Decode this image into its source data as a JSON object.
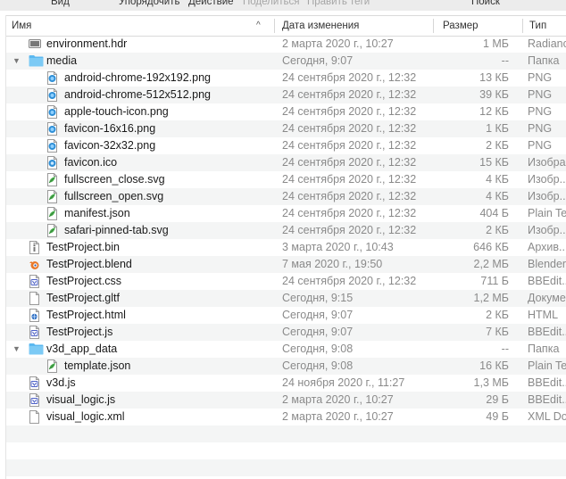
{
  "toolbar": {
    "items": [
      "Вид",
      "Упорядочить",
      "Действие",
      "Поделиться",
      "Править теги",
      "Поиск"
    ]
  },
  "columns": {
    "name": "Имя",
    "sort_indicator": "^",
    "date": "Дата изменения",
    "size": "Размер",
    "type": "Тип"
  },
  "files": [
    {
      "name": "environment.hdr",
      "date": "2 марта 2020 г., 10:27",
      "size": "1 МБ",
      "type": "Radiance",
      "level": 0,
      "icon": "hdr-file-icon"
    },
    {
      "name": "media",
      "date": "Сегодня, 9:07",
      "size": "--",
      "type": "Папка",
      "level": 0,
      "icon": "folder-icon",
      "expanded": true
    },
    {
      "name": "android-chrome-192x192.png",
      "date": "24 сентября 2020 г., 12:32",
      "size": "13 КБ",
      "type": "PNG",
      "level": 1,
      "icon": "png-file-icon"
    },
    {
      "name": "android-chrome-512x512.png",
      "date": "24 сентября 2020 г., 12:32",
      "size": "39 КБ",
      "type": "PNG",
      "level": 1,
      "icon": "png-file-icon"
    },
    {
      "name": "apple-touch-icon.png",
      "date": "24 сентября 2020 г., 12:32",
      "size": "12 КБ",
      "type": "PNG",
      "level": 1,
      "icon": "png-file-icon"
    },
    {
      "name": "favicon-16x16.png",
      "date": "24 сентября 2020 г., 12:32",
      "size": "1 КБ",
      "type": "PNG",
      "level": 1,
      "icon": "png-file-icon"
    },
    {
      "name": "favicon-32x32.png",
      "date": "24 сентября 2020 г., 12:32",
      "size": "2 КБ",
      "type": "PNG",
      "level": 1,
      "icon": "png-file-icon"
    },
    {
      "name": "favicon.ico",
      "date": "24 сентября 2020 г., 12:32",
      "size": "15 КБ",
      "type": "Изобра",
      "level": 1,
      "icon": "ico-file-icon"
    },
    {
      "name": "fullscreen_close.svg",
      "date": "24 сентября 2020 г., 12:32",
      "size": "4 КБ",
      "type": "Изобр...",
      "level": 1,
      "icon": "svg-file-icon"
    },
    {
      "name": "fullscreen_open.svg",
      "date": "24 сентября 2020 г., 12:32",
      "size": "4 КБ",
      "type": "Изобр...",
      "level": 1,
      "icon": "svg-file-icon"
    },
    {
      "name": "manifest.json",
      "date": "24 сентября 2020 г., 12:32",
      "size": "404 Б",
      "type": "Plain Te",
      "level": 1,
      "icon": "json-file-icon"
    },
    {
      "name": "safari-pinned-tab.svg",
      "date": "24 сентября 2020 г., 12:32",
      "size": "2 КБ",
      "type": "Изобр...",
      "level": 1,
      "icon": "svg-file-icon"
    },
    {
      "name": "TestProject.bin",
      "date": "3 марта 2020 г., 10:43",
      "size": "646 КБ",
      "type": "Архив...",
      "level": 0,
      "icon": "bin-file-icon"
    },
    {
      "name": "TestProject.blend",
      "date": "7 мая 2020 г., 19:50",
      "size": "2,2 МБ",
      "type": "Blender",
      "level": 0,
      "icon": "blend-file-icon"
    },
    {
      "name": "TestProject.css",
      "date": "24 сентября 2020 г., 12:32",
      "size": "711 Б",
      "type": "BBEdit...",
      "level": 0,
      "icon": "css-file-icon"
    },
    {
      "name": "TestProject.gltf",
      "date": "Сегодня, 9:15",
      "size": "1,2 МБ",
      "type": "Докуме",
      "level": 0,
      "icon": "gltf-file-icon"
    },
    {
      "name": "TestProject.html",
      "date": "Сегодня, 9:07",
      "size": "2 КБ",
      "type": "HTML",
      "level": 0,
      "icon": "html-file-icon"
    },
    {
      "name": "TestProject.js",
      "date": "Сегодня, 9:07",
      "size": "7 КБ",
      "type": "BBEdit...",
      "level": 0,
      "icon": "js-file-icon"
    },
    {
      "name": "v3d_app_data",
      "date": "Сегодня, 9:08",
      "size": "--",
      "type": "Папка",
      "level": 0,
      "icon": "folder-icon",
      "expanded": true
    },
    {
      "name": "template.json",
      "date": "Сегодня, 9:08",
      "size": "16 КБ",
      "type": "Plain Te",
      "level": 1,
      "icon": "json-file-icon"
    },
    {
      "name": "v3d.js",
      "date": "24 ноября 2020 г., 11:27",
      "size": "1,3 МБ",
      "type": "BBEdit...",
      "level": 0,
      "icon": "js-file-icon"
    },
    {
      "name": "visual_logic.js",
      "date": "2 марта 2020 г., 10:27",
      "size": "29 Б",
      "type": "BBEdit...",
      "level": 0,
      "icon": "js-file-icon"
    },
    {
      "name": "visual_logic.xml",
      "date": "2 марта 2020 г., 10:27",
      "size": "49 Б",
      "type": "XML Do",
      "level": 0,
      "icon": "xml-file-icon"
    }
  ],
  "empty_rows": 3,
  "colors": {
    "folder": "#5bb8f0",
    "png_badge": "#2f8fd6",
    "svg_badge": "#4caf50",
    "blend": "#e8782a",
    "js_badge": "#4b5fc6",
    "alt_row": "#f4f5f5",
    "secondary_text": "#8a8a8a"
  }
}
